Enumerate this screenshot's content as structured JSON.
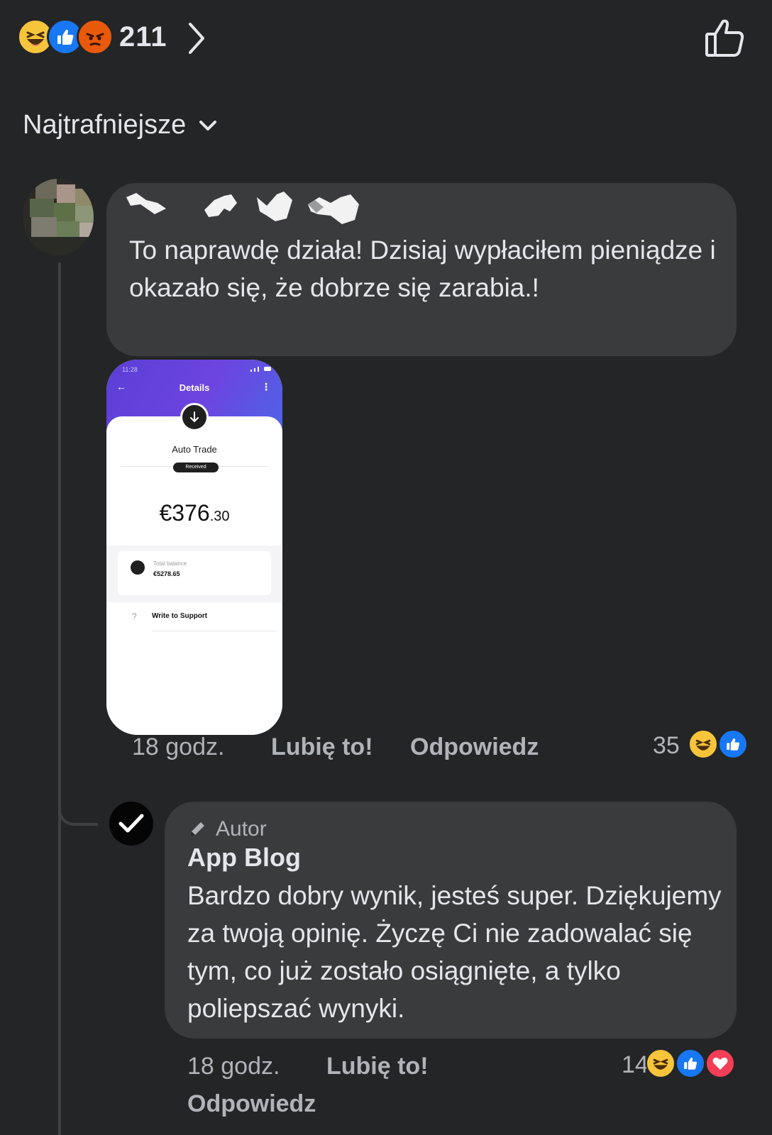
{
  "reactions_summary": {
    "count": "211",
    "icons": [
      "haha-icon",
      "like-icon",
      "angry-icon"
    ]
  },
  "sort": {
    "label": "Najtrafniejsze"
  },
  "comment": {
    "text": "To naprawdę działa! Dzisiaj wypłaciłem pieniądze i okazało się, że dobrze się zarabia.!",
    "time": "18 godz.",
    "like_label": "Lubię to!",
    "reply_label": "Odpowiedz",
    "reaction_count": "35",
    "reaction_icons": [
      "haha-icon",
      "like-icon"
    ]
  },
  "attachment": {
    "status_time": "11:28",
    "title": "Details",
    "type_label": "Auto Trade",
    "status_badge": "Received",
    "amount_main": "€376",
    "amount_cents": ".30",
    "balance_label": "Total balance",
    "balance_value": "€5278.65",
    "support_label": "Write to Support"
  },
  "reply": {
    "badge": "Autor",
    "author": "App Blog",
    "text": "Bardzo dobry wynik, jesteś super. Dziękujemy za twoją opinię. Życzę Ci nie zadowalać się tym, co już zostało osiągnięte, a tylko poliepszać wynyki.",
    "time": "18 godz.",
    "like_label": "Lubię to!",
    "reply_label": "Odpowiedz",
    "reaction_count": "14",
    "reaction_icons": [
      "haha-icon",
      "like-icon",
      "love-icon"
    ]
  },
  "colors": {
    "background": "#242526",
    "bubble": "#3a3b3c",
    "like_blue": "#1877f2",
    "haha_yellow": "#f7c53b",
    "angry_orange": "#e9590b",
    "love_red": "#f33e58"
  }
}
